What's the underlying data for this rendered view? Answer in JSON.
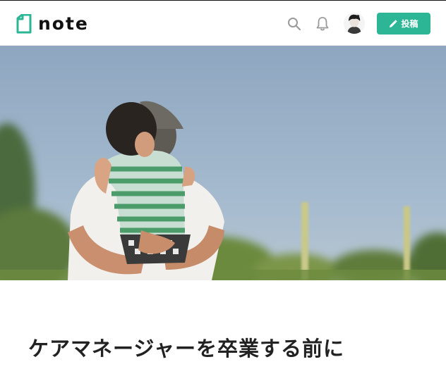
{
  "header": {
    "logo_text": "note",
    "post_button_label": "投稿",
    "icons": [
      "search-icon",
      "bell-icon",
      "pencil-icon"
    ],
    "accent_color": "#2cb696"
  },
  "article": {
    "title": "ケアマネージャーを卒業する前に"
  }
}
